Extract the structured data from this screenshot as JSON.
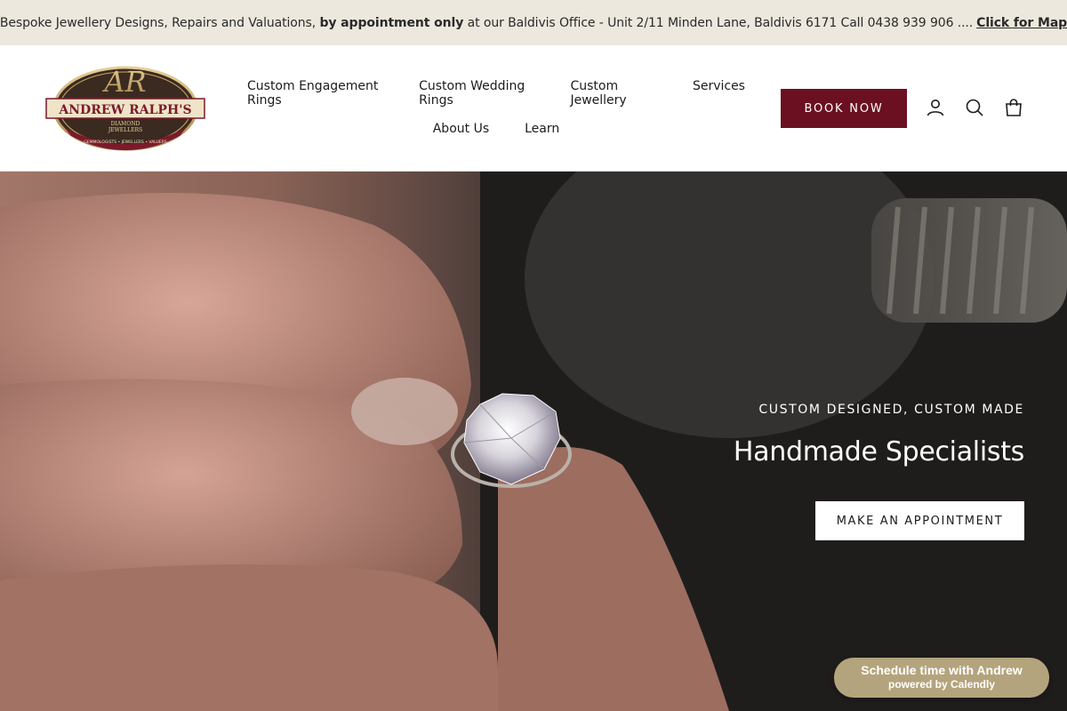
{
  "announcement": {
    "text_before": "Bespoke Jewellery Designs, Repairs and Valuations,",
    "text_bold": "by appointment only",
    "text_after": "at our Baldivis Office - Unit 2/11 Minden Lane, Baldivis 6171 Call 0438 939 906 ....",
    "link_label": "Click for Map"
  },
  "logo": {
    "monogram": "AR",
    "name": "ANDREW RALPH'S",
    "line2": "DIAMOND",
    "line3": "JEWELLERS",
    "tagline": "GEMMOLOGISTS • JEWELLERS • VALUERS",
    "colors": {
      "maroon": "#7b1a2b",
      "gold": "#c8a96b",
      "dark": "#3a2a22"
    }
  },
  "nav": {
    "row1": [
      "Custom Engagement Rings",
      "Custom Wedding Rings",
      "Custom Jewellery",
      "Services"
    ],
    "row2": [
      "About Us",
      "Learn"
    ]
  },
  "header": {
    "book_label": "BOOK NOW",
    "icons": [
      "account-icon",
      "search-icon",
      "cart-icon"
    ]
  },
  "hero": {
    "eyebrow": "CUSTOM DESIGNED, CUSTOM MADE",
    "title": "Handmade Specialists",
    "button_label": "MAKE AN APPOINTMENT"
  },
  "calendly": {
    "line1": "Schedule time with Andrew",
    "line2": "powered by Calendly"
  },
  "colors": {
    "announce_bg": "#ede8dd",
    "accent": "#6b1020",
    "calendly_bg": "#b4a47d"
  }
}
